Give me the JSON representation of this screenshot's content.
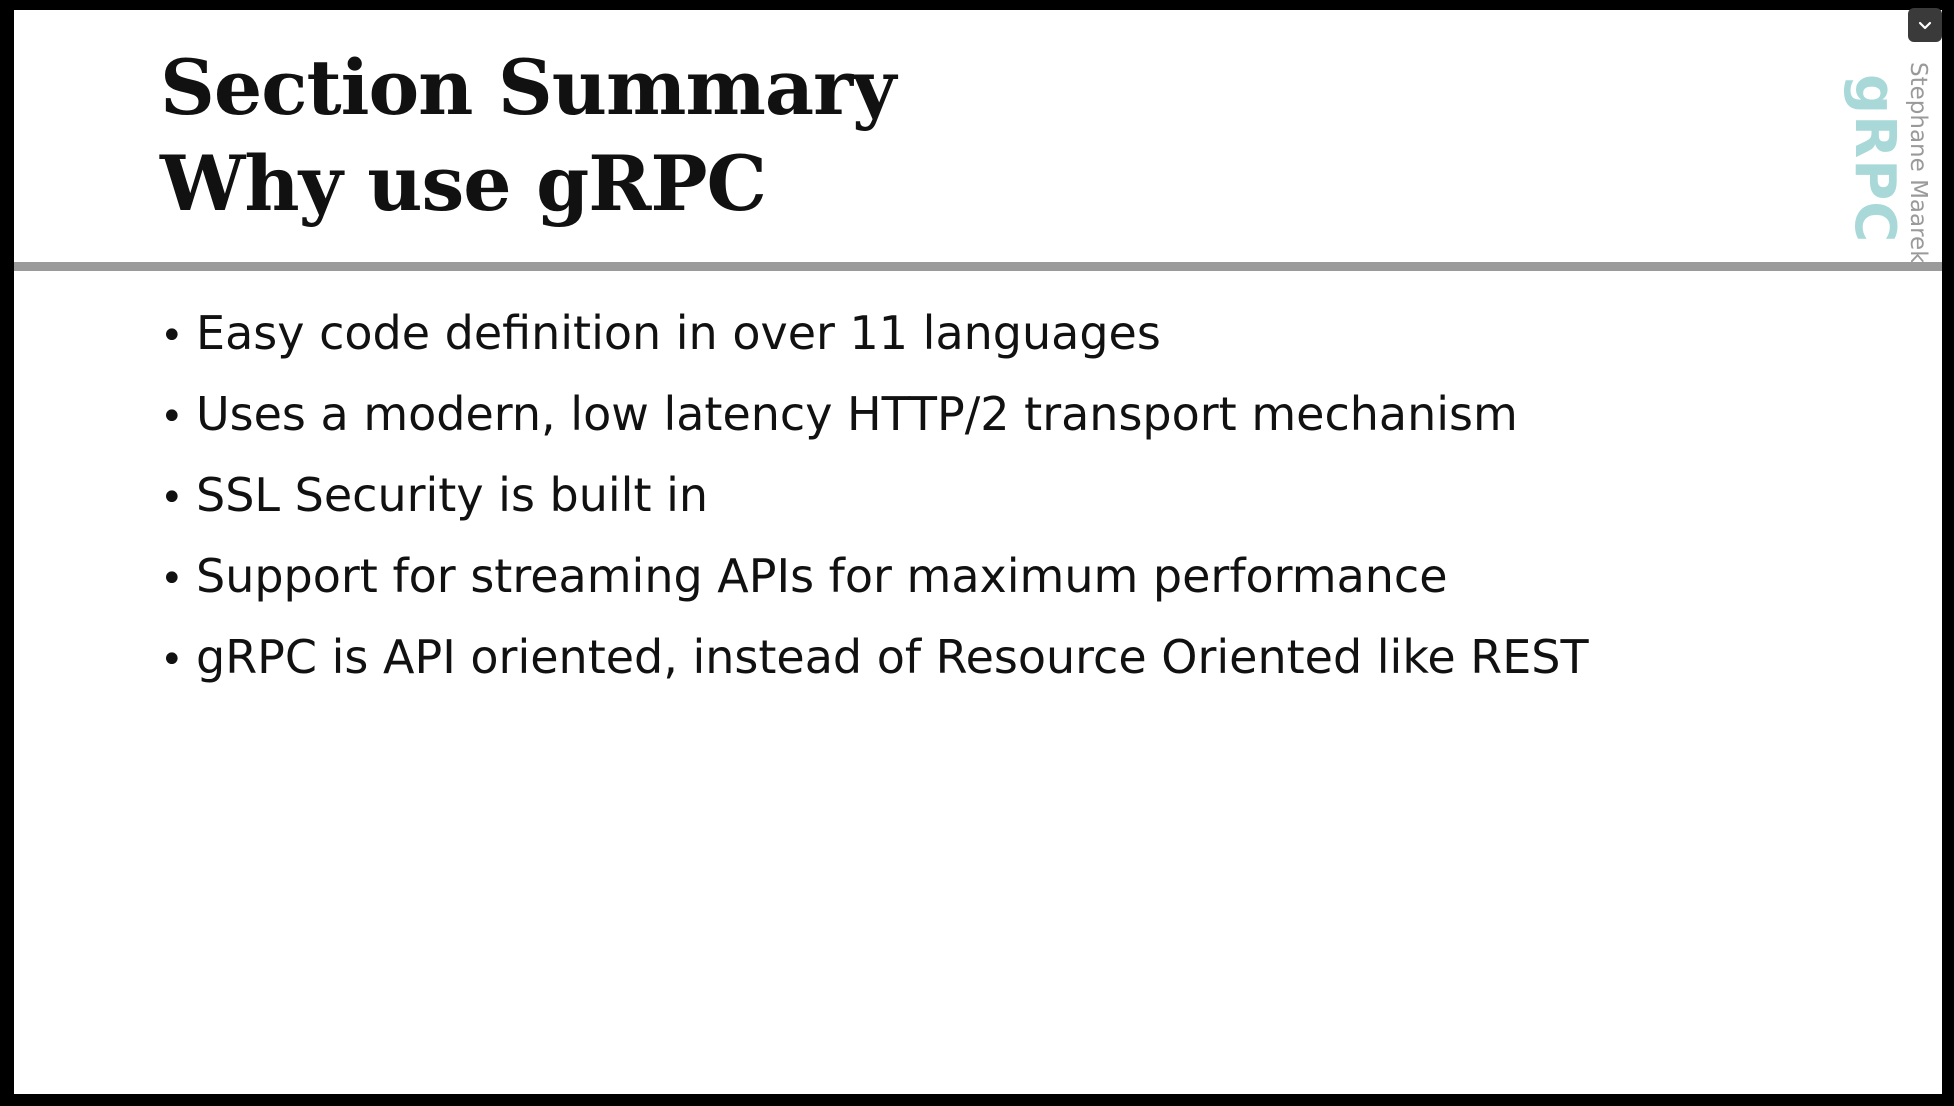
{
  "slide": {
    "title_lines": [
      "Section Summary",
      "Why use gRPC"
    ],
    "bullets": [
      "Easy code definition in over 11 languages",
      "Uses a modern, low latency HTTP/2 transport mechanism",
      "SSL Security is built in",
      "Support for streaming APIs for maximum performance",
      "gRPC is API oriented, instead of Resource Oriented like REST"
    ],
    "bullet_symbol": "•",
    "logo_text": "gRPC",
    "author": "Stephane Maarek"
  },
  "controls": {
    "collapse_icon": "chevron-down-icon"
  },
  "colors": {
    "background_frame": "#000000",
    "slide_background": "#ffffff",
    "text": "#111111",
    "divider": "#9a9a9a",
    "logo": "#a8d8d8",
    "author": "#9a9a9a",
    "button": "#3a3a3a"
  }
}
